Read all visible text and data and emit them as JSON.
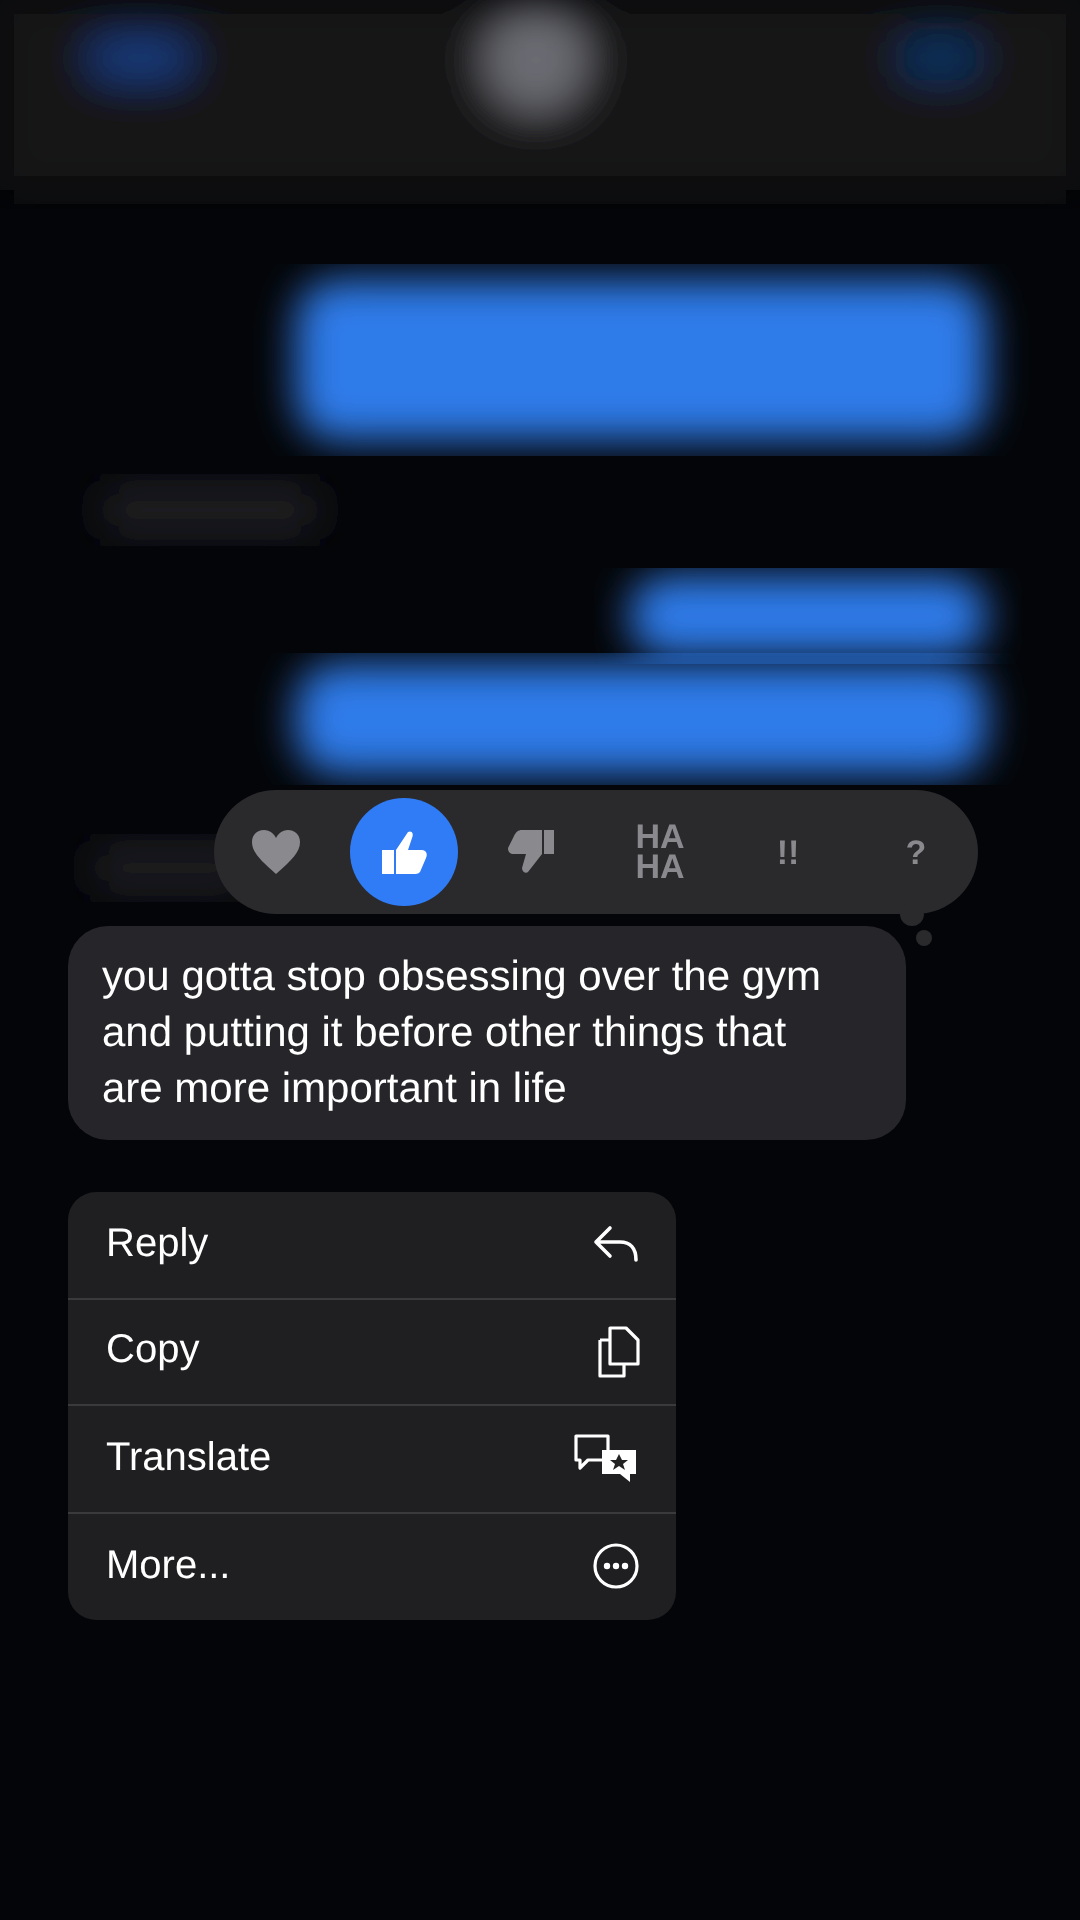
{
  "tapbacks": [
    {
      "kind": "heart",
      "selected": false
    },
    {
      "kind": "thumbs-up",
      "selected": true
    },
    {
      "kind": "thumbs-down",
      "selected": false
    },
    {
      "kind": "text",
      "label": "HA HA",
      "selected": false
    },
    {
      "kind": "text",
      "label": "!!",
      "selected": false
    },
    {
      "kind": "text",
      "label": "?",
      "selected": false
    }
  ],
  "message": {
    "text": "you gotta stop obsessing over the gym and putting it before other things that are more important in life"
  },
  "menu": [
    {
      "label": "Reply",
      "kind": "reply"
    },
    {
      "label": "Copy",
      "kind": "copy"
    },
    {
      "label": "Translate",
      "kind": "translate"
    },
    {
      "label": "More...",
      "kind": "more"
    }
  ]
}
